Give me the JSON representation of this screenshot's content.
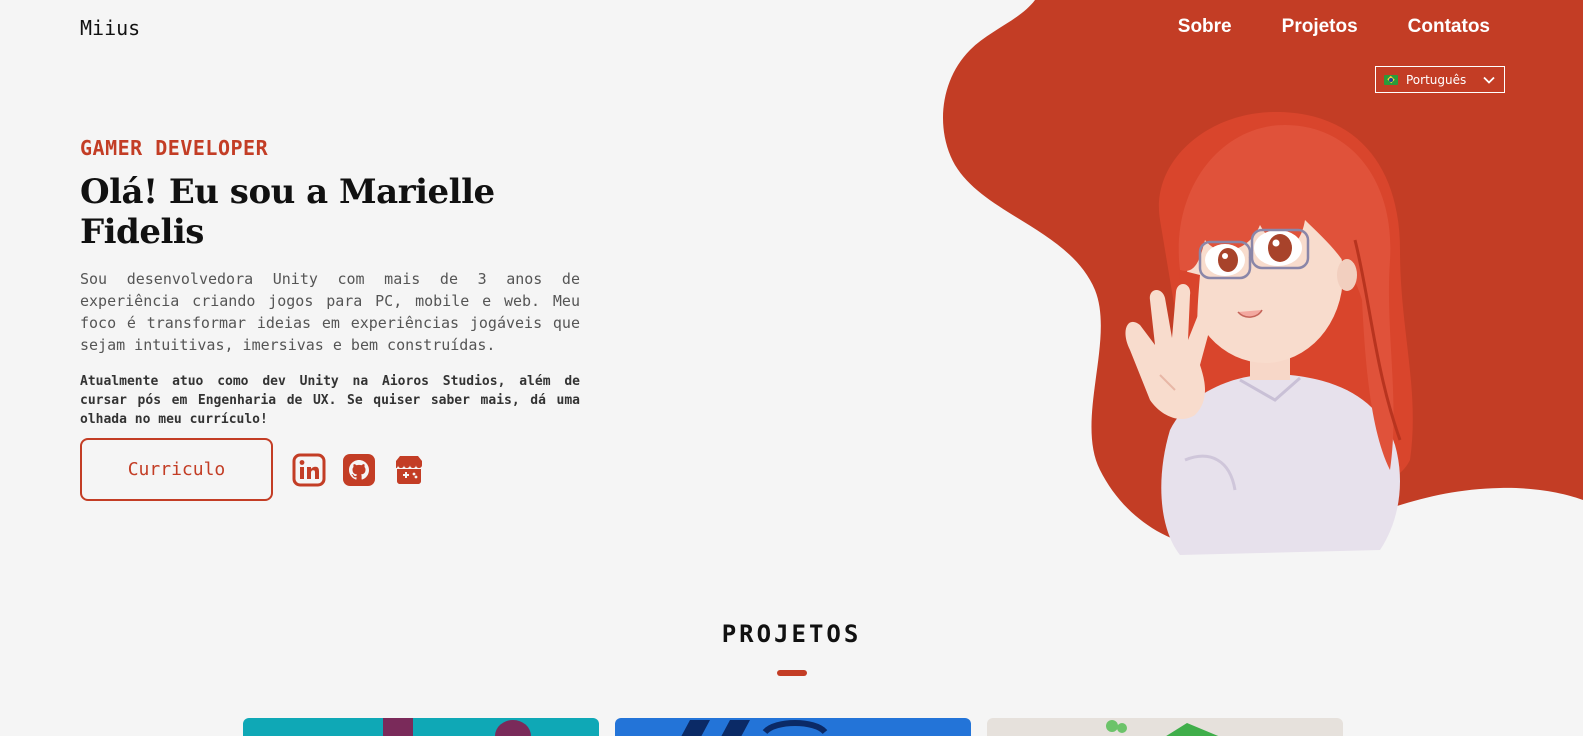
{
  "header": {
    "logo": "Miius",
    "nav": [
      "Sobre",
      "Projetos",
      "Contatos"
    ],
    "language": {
      "selected": "Português"
    }
  },
  "hero": {
    "eyebrow": "GAMER DEVELOPER",
    "title": "Olá! Eu sou a Marielle Fidelis",
    "description": "Sou desenvolvedora Unity com mais de 3 anos de experiência criando jogos para PC, mobile e web. Meu foco é transformar ideias em experiências jogáveis que sejam intuitivas, imersivas e bem construídas.",
    "description_bold": "Atualmente atuo como dev Unity na Aioros Studios, além de cursar pós em Engenharia de UX. Se quiser saber mais, dá uma olhada no meu currículo!",
    "cv_button": "Curriculo",
    "social_icons": [
      "linkedin-icon",
      "github-icon",
      "itchio-icon"
    ]
  },
  "projects": {
    "title": "PROJETOS"
  },
  "colors": {
    "accent": "#c33d25",
    "background": "#f5f5f5"
  }
}
